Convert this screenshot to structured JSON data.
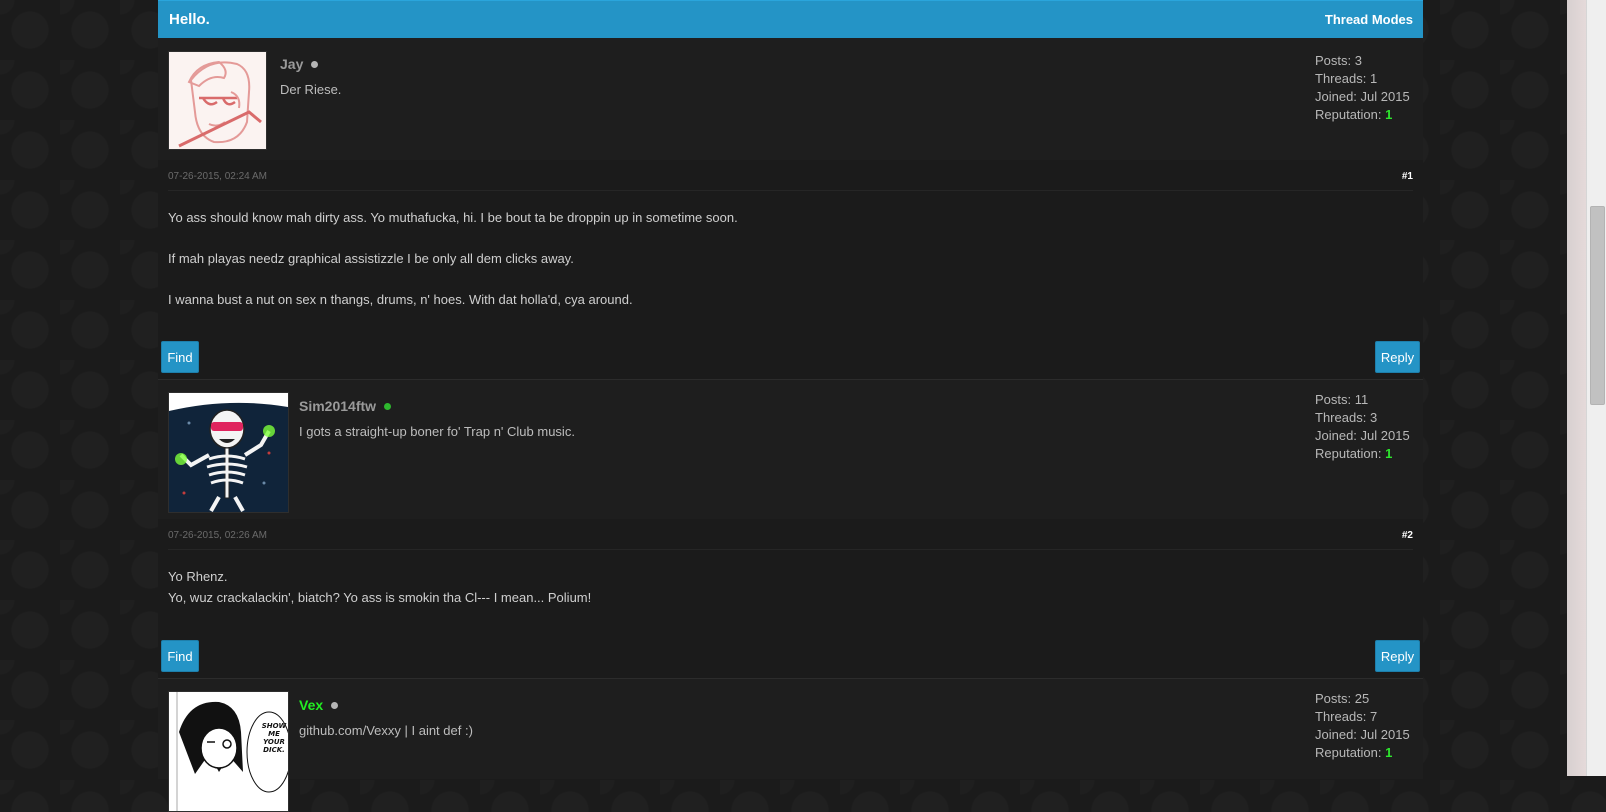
{
  "thread": {
    "title": "Hello.",
    "modes_label": "Thread Modes"
  },
  "labels": {
    "posts": "Posts:",
    "threads": "Threads:",
    "joined": "Joined:",
    "reputation": "Reputation:",
    "find": "Find",
    "reply": "Reply"
  },
  "posts": [
    {
      "username": "Jay",
      "online": false,
      "signature": "Der Riese.",
      "stats": {
        "posts": "3",
        "threads": "1",
        "joined": "Jul 2015",
        "reputation": "1"
      },
      "date": "07-26-2015, 02:24 AM",
      "number": "#1",
      "body": [
        "Yo ass should know mah dirty ass. Yo muthafucka, hi. I be bout ta be droppin up in sometime soon.",
        "If mah playas needz graphical assistizzle I be only all dem clicks away.",
        "I wanna bust a nut on sex n thangs, drums, n' hoes. With dat holla'd, cya around."
      ]
    },
    {
      "username": "Sim2014ftw",
      "online": true,
      "signature": "I gots a straight-up boner fo' Trap n' Club music.",
      "stats": {
        "posts": "11",
        "threads": "3",
        "joined": "Jul 2015",
        "reputation": "1"
      },
      "date": "07-26-2015, 02:26 AM",
      "number": "#2",
      "body": [
        "Yo Rhenz.",
        "Yo, wuz crackalackin', biatch? Yo ass is smokin tha Cl--- I mean... Polium!"
      ]
    },
    {
      "username": "Vex",
      "online": false,
      "signature": "github.com/Vexxy | I aint def :)",
      "stats": {
        "posts": "25",
        "threads": "7",
        "joined": "Jul 2015",
        "reputation": "1"
      },
      "avatar_text": [
        "SHOW",
        "ME",
        "YOUR",
        "DICK."
      ]
    }
  ],
  "colors": {
    "accent": "#2494c6",
    "background": "#1b1b1b",
    "reputation": "#2ee52e",
    "online": "#2eb82e",
    "offline": "#b5b5b5",
    "highlight_username": "#22ee22"
  }
}
